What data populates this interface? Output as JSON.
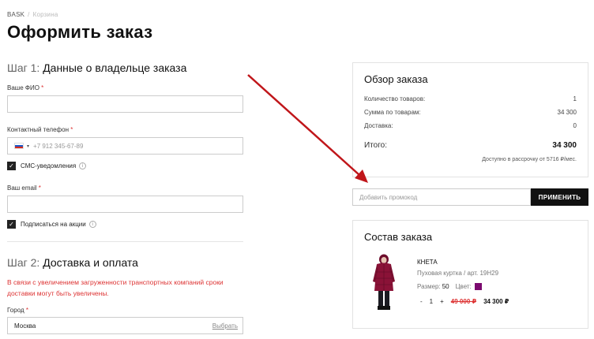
{
  "breadcrumb": {
    "home": "BASK",
    "separator": "/",
    "current": "Корзина"
  },
  "page_title": "Оформить заказ",
  "step1": {
    "num": "Шаг 1:",
    "title": "Данные о владельце заказа",
    "name_label": "Ваше ФИО",
    "phone_label": "Контактный телефон",
    "phone_placeholder": "+7 912 345-67-89",
    "sms_label": "СМС-уведомления",
    "email_label": "Ваш email",
    "subscribe_label": "Подписаться на акции",
    "required_mark": "*"
  },
  "step2": {
    "num": "Шаг 2:",
    "title": "Доставка и оплата",
    "warning": "В связи с увеличением загруженности транспортных компаний сроки доставки могут быть увеличены.",
    "city_label": "Город",
    "city_value": "Москва",
    "city_select": "Выбрать"
  },
  "summary": {
    "title": "Обзор заказа",
    "rows": [
      {
        "label": "Количество товаров:",
        "value": "1"
      },
      {
        "label": "Сумма по товарам:",
        "value": "34 300"
      },
      {
        "label": "Доставка:",
        "value": "0"
      }
    ],
    "total_label": "Итого:",
    "total_value": "34 300",
    "installment": "Доступно в рассрочку от 5716 ₽/мес."
  },
  "promo": {
    "placeholder": "Добавить промокод",
    "button": "ПРИМЕНИТЬ"
  },
  "composition": {
    "title": "Состав заказа",
    "item": {
      "name": "КНЕТА",
      "subtitle": "Пуховая куртка / арт. 19Н29",
      "size_label": "Размер:",
      "size_value": "50",
      "color_label": "Цвет:",
      "color_hex": "#7b0a6f",
      "minus": "-",
      "qty": "1",
      "plus": "+",
      "old_price": "49 000 ₽",
      "new_price": "34 300 ₽"
    }
  },
  "colors": {
    "accent_red": "#d33333",
    "arrow": "#c0161a",
    "button_bg": "#111111"
  }
}
